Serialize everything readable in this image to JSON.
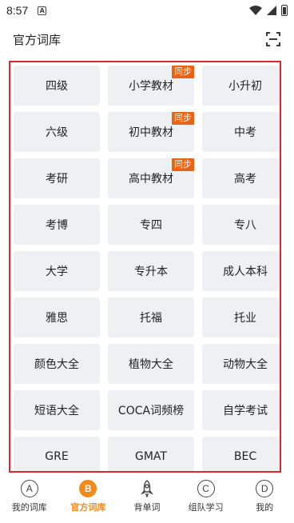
{
  "status_bar": {
    "time": "8:57",
    "notification_glyph": "A"
  },
  "header": {
    "title": "官方词库"
  },
  "sync_badge_text": "同步",
  "accent_color": "#e86314",
  "categories": [
    {
      "label": "四级",
      "sync": false
    },
    {
      "label": "小学教材",
      "sync": true
    },
    {
      "label": "小升初",
      "sync": false
    },
    {
      "label": "六级",
      "sync": false
    },
    {
      "label": "初中教材",
      "sync": true
    },
    {
      "label": "中考",
      "sync": false
    },
    {
      "label": "考研",
      "sync": false
    },
    {
      "label": "高中教材",
      "sync": true
    },
    {
      "label": "高考",
      "sync": false
    },
    {
      "label": "考博",
      "sync": false
    },
    {
      "label": "专四",
      "sync": false
    },
    {
      "label": "专八",
      "sync": false
    },
    {
      "label": "大学",
      "sync": false
    },
    {
      "label": "专升本",
      "sync": false
    },
    {
      "label": "成人本科",
      "sync": false
    },
    {
      "label": "雅思",
      "sync": false
    },
    {
      "label": "托福",
      "sync": false
    },
    {
      "label": "托业",
      "sync": false
    },
    {
      "label": "颜色大全",
      "sync": false
    },
    {
      "label": "植物大全",
      "sync": false
    },
    {
      "label": "动物大全",
      "sync": false
    },
    {
      "label": "短语大全",
      "sync": false
    },
    {
      "label": "COCA词频榜",
      "sync": false
    },
    {
      "label": "自学考试",
      "sync": false
    },
    {
      "label": "GRE",
      "sync": false
    },
    {
      "label": "GMAT",
      "sync": false
    },
    {
      "label": "BEC",
      "sync": false
    }
  ],
  "bottom_nav": [
    {
      "icon": "A",
      "icon_name": "circle-a-icon",
      "label": "我的词库",
      "active": false
    },
    {
      "icon": "B",
      "icon_name": "circle-b-icon",
      "label": "官方词库",
      "active": true
    },
    {
      "icon": "",
      "icon_name": "rocket-icon",
      "label": "背单词",
      "active": false
    },
    {
      "icon": "C",
      "icon_name": "circle-c-icon",
      "label": "组队学习",
      "active": false
    },
    {
      "icon": "D",
      "icon_name": "circle-d-icon",
      "label": "我的",
      "active": false
    }
  ]
}
